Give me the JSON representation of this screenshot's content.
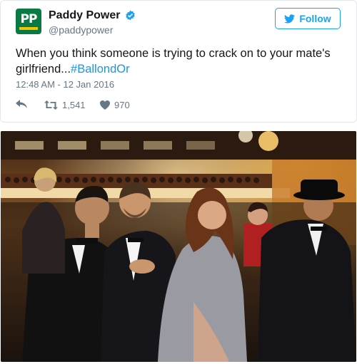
{
  "tweet": {
    "author_name": "Paddy Power",
    "author_handle": "@paddypower",
    "avatar_text": "PP",
    "follow_label": "Follow",
    "text_plain": "When you think someone is trying to crack on to your mate's girlfriend...",
    "hashtag": "#BallondOr",
    "timestamp": "12:48 AM - 12 Jan 2016",
    "retweets": "1,541",
    "likes": "970"
  },
  "icons": {
    "verified": "verified-badge-icon",
    "follow": "twitter-bird-icon",
    "reply": "reply-icon",
    "retweet": "retweet-icon",
    "like": "heart-icon"
  },
  "colors": {
    "brand_green": "#0a7a45",
    "twitter_blue": "#1da1f2",
    "hashtag_blue": "#1b95e0",
    "muted_text": "#657786"
  }
}
